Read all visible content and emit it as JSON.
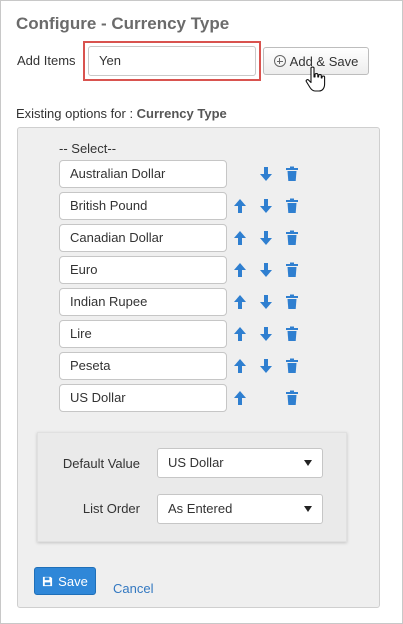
{
  "header": {
    "title": "Configure - Currency Type"
  },
  "add_items": {
    "label": "Add Items",
    "input_value": "Yen",
    "button_label": "Add & Save"
  },
  "existing": {
    "label_prefix": "Existing options for : ",
    "label_strong": "Currency Type",
    "select_hint": "-- Select--",
    "options": [
      "Australian Dollar",
      "British Pound",
      "Canadian Dollar",
      "Euro",
      "Indian Rupee",
      "Lire",
      "Peseta",
      "US Dollar"
    ]
  },
  "settings": {
    "default_value_label": "Default Value",
    "default_value": "US Dollar",
    "list_order_label": "List Order",
    "list_order": "As Entered"
  },
  "footer": {
    "save_label": "Save",
    "cancel_label": "Cancel"
  },
  "colors": {
    "accent": "#2f87d8",
    "highlight_border": "#d9534f",
    "icon_blue": "#2f7fd0"
  },
  "icons": {
    "move_up": "arrow-up-icon",
    "move_down": "arrow-down-icon",
    "delete": "trash-icon",
    "add": "plus-circle-icon",
    "save": "floppy-disk-icon",
    "pointer": "hand-cursor-icon"
  }
}
